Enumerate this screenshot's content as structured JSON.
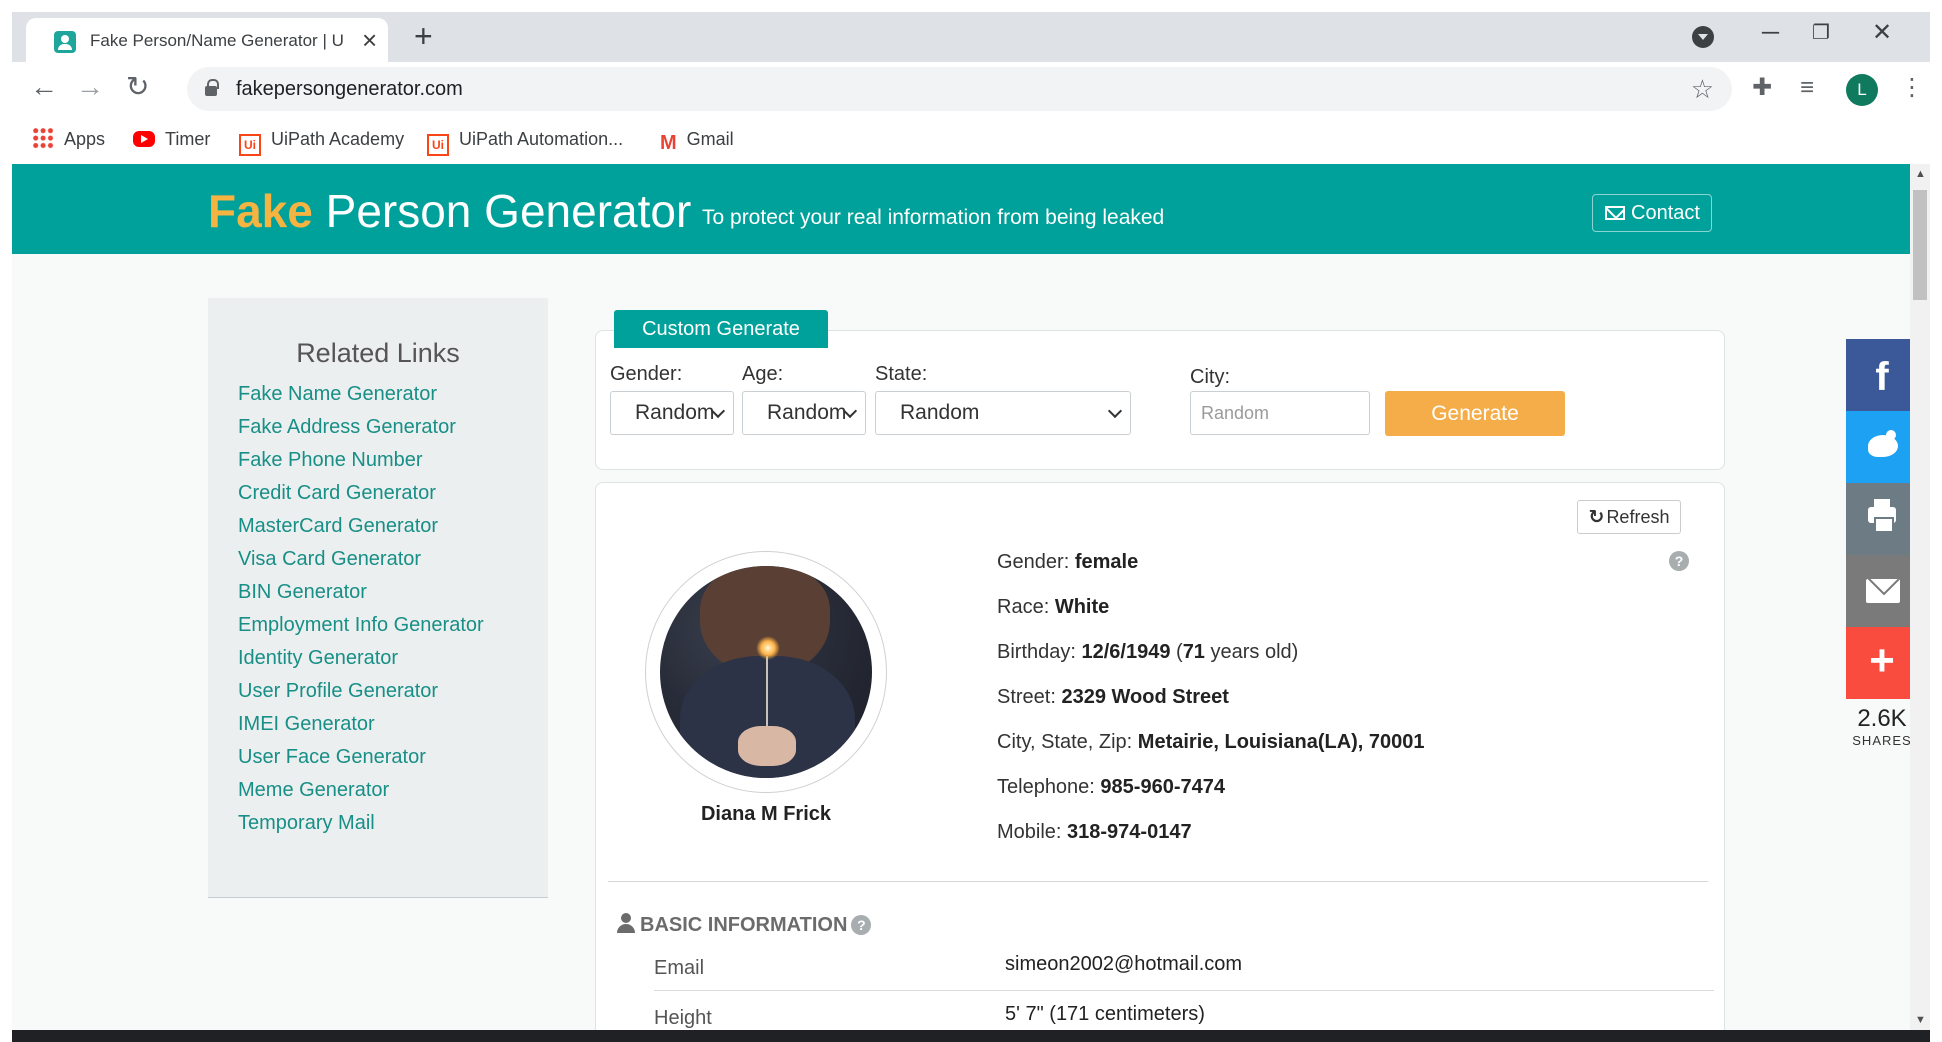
{
  "browser": {
    "tab_title": "Fake Person/Name Generator | U",
    "url": "fakepersongenerator.com",
    "profile_initial": "L",
    "bookmarks": [
      {
        "label": "Apps",
        "icon": "apps-grid-icon"
      },
      {
        "label": "Timer",
        "icon": "youtube-icon"
      },
      {
        "label": "UiPath Academy",
        "icon": "uipath-icon"
      },
      {
        "label": "UiPath Automation...",
        "icon": "uipath-icon"
      },
      {
        "label": "Gmail",
        "icon": "gmail-icon"
      }
    ]
  },
  "header": {
    "brand_fake": "Fake",
    "brand_rest": "Person Generator",
    "tagline": "To protect your real information from being leaked",
    "contact_label": "Contact",
    "bg_color": "#00a19a",
    "accent_color": "#f5b342"
  },
  "sidebar": {
    "title": "Related Links",
    "links": [
      "Fake Name Generator",
      "Fake Address Generator",
      "Fake Phone Number",
      "Credit Card Generator",
      "MasterCard Generator",
      "Visa Card Generator",
      "BIN Generator",
      "Employment Info Generator",
      "Identity Generator",
      "User Profile Generator",
      "IMEI Generator",
      "User Face Generator",
      "Meme Generator",
      "Temporary Mail"
    ]
  },
  "generator": {
    "tab_label": "Custom Generate",
    "gender_label": "Gender:",
    "gender_value": "Random",
    "age_label": "Age:",
    "age_value": "Random",
    "state_label": "State:",
    "state_value": "Random",
    "city_label": "City:",
    "city_placeholder": "Random",
    "generate_label": "Generate"
  },
  "person": {
    "refresh_label": "Refresh",
    "name": "Diana M Frick",
    "help_glyph": "?",
    "details": [
      {
        "label": "Gender: ",
        "value": "female",
        "suffix": ""
      },
      {
        "label": "Race: ",
        "value": "White",
        "suffix": ""
      },
      {
        "label": "Birthday: ",
        "value": "12/6/1949",
        "suffix": " (",
        "value2": "71",
        "suffix2": " years old)"
      },
      {
        "label": "Street: ",
        "value": "2329 Wood Street",
        "suffix": ""
      },
      {
        "label": "City, State, Zip: ",
        "value": "Metairie, Louisiana(LA), 70001",
        "suffix": ""
      },
      {
        "label": "Telephone: ",
        "value": "985-960-7474",
        "suffix": ""
      },
      {
        "label": "Mobile: ",
        "value": "318-974-0147",
        "suffix": ""
      }
    ],
    "section_title": "BASIC INFORMATION",
    "basic_info": [
      {
        "label": "Email",
        "value": "simeon2002@hotmail.com"
      },
      {
        "label": "Height",
        "value": "5' 7\" (171 centimeters)"
      }
    ]
  },
  "share": {
    "count": "2.6K",
    "label": "SHARES",
    "buttons": [
      "facebook-icon",
      "twitter-icon",
      "print-icon",
      "email-icon",
      "plus-icon"
    ]
  }
}
